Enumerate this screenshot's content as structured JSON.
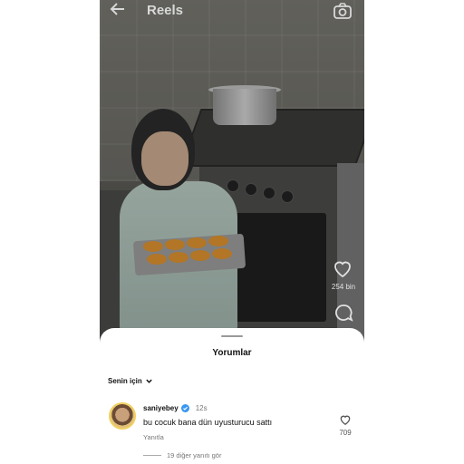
{
  "header": {
    "title": "Reels",
    "back_icon": "arrow-left-icon",
    "camera_icon": "camera-icon"
  },
  "actions": {
    "like_count": "254 bin"
  },
  "comments_sheet": {
    "title": "Yorumlar",
    "sort_label": "Senin için",
    "comment": {
      "username": "saniyebey",
      "time": "12s",
      "text": "bu cocuk bana dün uyusturucu sattı",
      "reply_label": "Yanıtla",
      "like_count": "709",
      "view_replies": "19 diğer yanıtı gör"
    }
  },
  "colors": {
    "verified": "#3897f0",
    "sheet_bg": "#ffffff"
  }
}
